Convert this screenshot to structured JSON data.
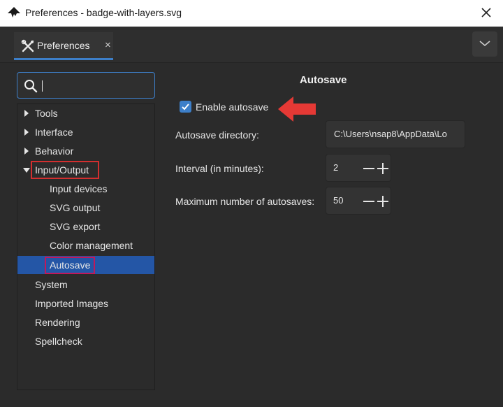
{
  "window": {
    "title": "Preferences - badge-with-layers.svg"
  },
  "tabs": [
    {
      "label": "Preferences",
      "close": "×",
      "active": true
    }
  ],
  "search": {
    "value": "",
    "placeholder": ""
  },
  "tree": {
    "items": [
      {
        "label": "Tools",
        "level": 0,
        "expander": "collapsed"
      },
      {
        "label": "Interface",
        "level": 0,
        "expander": "collapsed"
      },
      {
        "label": "Behavior",
        "level": 0,
        "expander": "collapsed"
      },
      {
        "label": "Input/Output",
        "level": 0,
        "expander": "expanded",
        "highlight": "red"
      },
      {
        "label": "Input devices",
        "level": 1
      },
      {
        "label": "SVG output",
        "level": 1
      },
      {
        "label": "SVG export",
        "level": 1
      },
      {
        "label": "Color management",
        "level": 1
      },
      {
        "label": "Autosave",
        "level": 1,
        "selected": true,
        "highlight": "pink"
      },
      {
        "label": "System",
        "level": 0
      },
      {
        "label": "Imported Images",
        "level": 0
      },
      {
        "label": "Rendering",
        "level": 0
      },
      {
        "label": "Spellcheck",
        "level": 0
      }
    ]
  },
  "panel": {
    "title": "Autosave",
    "enable": {
      "label": "Enable autosave",
      "checked": true
    },
    "directory": {
      "label": "Autosave directory:",
      "value": "C:\\Users\\nsap8\\AppData\\Lo"
    },
    "interval": {
      "label": "Interval (in minutes):",
      "value": "2"
    },
    "max": {
      "label": "Maximum number of autosaves:",
      "value": "50"
    }
  },
  "colors": {
    "accent": "#3d7fc9",
    "selection": "#2456a6",
    "annotation_red": "#d32f2f",
    "annotation_pink": "#c2185b",
    "background": "#2b2b2b"
  },
  "icons": {
    "app": "inkscape-logo-icon",
    "tab": "preferences-tools-icon",
    "search": "search-icon",
    "close": "close-icon",
    "tab_menu": "chevron-down-icon"
  }
}
